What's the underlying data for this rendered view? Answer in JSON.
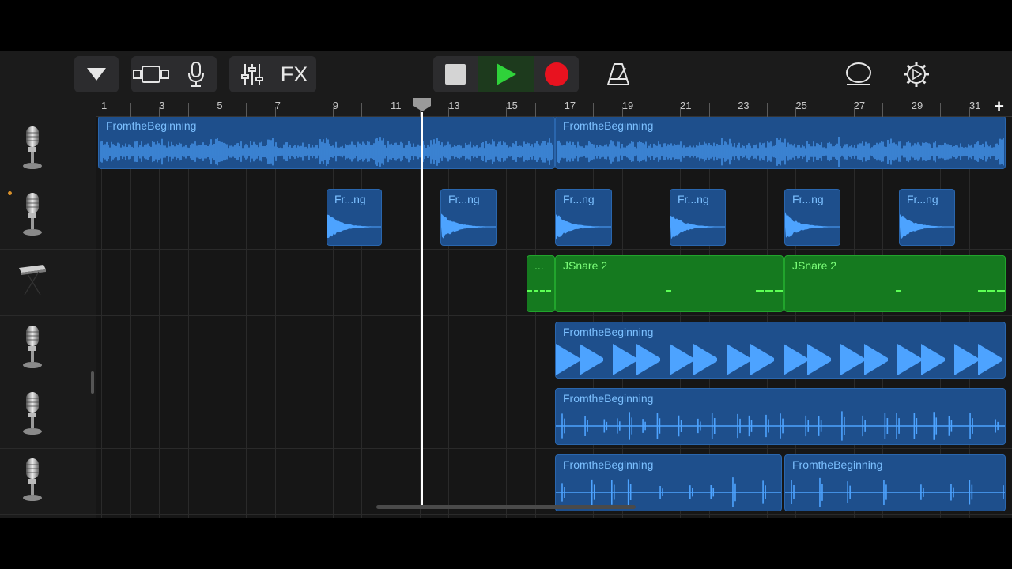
{
  "toolbar": {
    "fx_label": "FX",
    "transport": {
      "state": "stopped"
    }
  },
  "ruler": {
    "bar_numbers": [
      "1",
      "3",
      "5",
      "7",
      "9",
      "11",
      "13",
      "15",
      "17",
      "19",
      "21",
      "23",
      "25",
      "27",
      "29",
      "31"
    ],
    "add_label": "+"
  },
  "tracks": [
    {
      "icon": "microphone-icon",
      "regions": [
        {
          "label": "FromtheBeginning",
          "kind": "audio"
        },
        {
          "label": "FromtheBeginning",
          "kind": "audio"
        }
      ]
    },
    {
      "icon": "microphone-icon",
      "selected_dot": true,
      "regions": [
        {
          "label": "Fr...ng",
          "kind": "audio"
        },
        {
          "label": "Fr...ng",
          "kind": "audio"
        },
        {
          "label": "Fr...ng",
          "kind": "audio"
        },
        {
          "label": "Fr...ng",
          "kind": "audio"
        },
        {
          "label": "Fr...ng",
          "kind": "audio"
        },
        {
          "label": "Fr...ng",
          "kind": "audio"
        }
      ]
    },
    {
      "icon": "keyboard-icon",
      "regions": [
        {
          "label": "...",
          "kind": "midi"
        },
        {
          "label": "JSnare 2",
          "kind": "midi"
        },
        {
          "label": "JSnare 2",
          "kind": "midi"
        }
      ]
    },
    {
      "icon": "microphone-icon",
      "regions": [
        {
          "label": "FromtheBeginning",
          "kind": "audio"
        }
      ]
    },
    {
      "icon": "microphone-icon",
      "regions": [
        {
          "label": "FromtheBeginning",
          "kind": "audio"
        }
      ]
    },
    {
      "icon": "microphone-icon",
      "regions": [
        {
          "label": "FromtheBeginning",
          "kind": "audio"
        },
        {
          "label": "FromtheBeginning",
          "kind": "audio"
        }
      ]
    }
  ],
  "colors": {
    "audio_region": "#1e4f8c",
    "audio_wave": "#4da3ff",
    "midi_region": "#157a1f",
    "midi_notes": "#5dff55",
    "record": "#e8121f",
    "play": "#2fd23a"
  }
}
